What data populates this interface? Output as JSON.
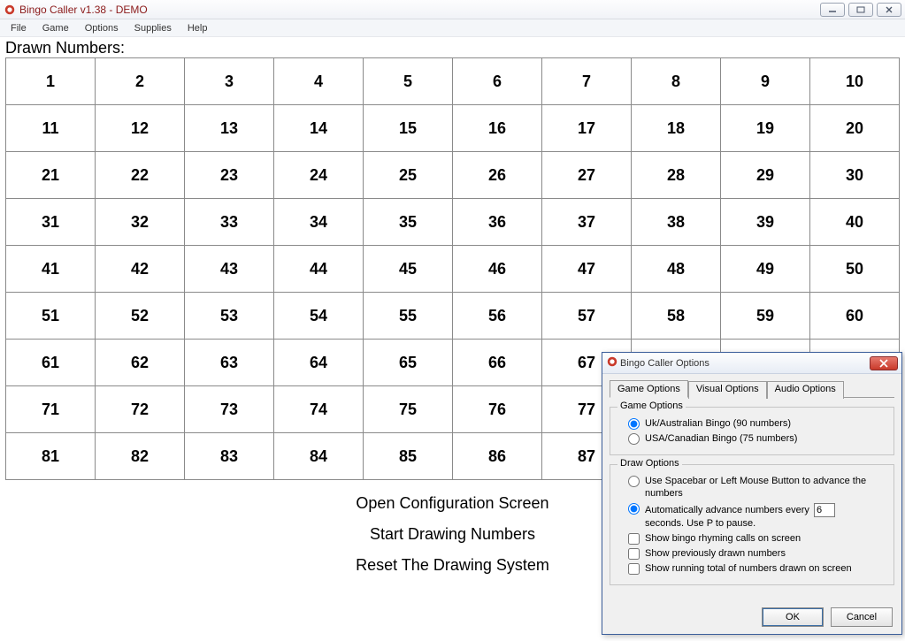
{
  "window": {
    "title": "Bingo Caller v1.38 - DEMO"
  },
  "menubar": [
    "File",
    "Game",
    "Options",
    "Supplies",
    "Help"
  ],
  "drawn_label": "Drawn Numbers:",
  "grid": {
    "rows": 9,
    "cols": 10,
    "start": 1
  },
  "actions": {
    "open_config": "Open Configuration Screen",
    "start_drawing": "Start Drawing Numbers",
    "reset": "Reset The Drawing System"
  },
  "dialog": {
    "title": "Bingo Caller Options",
    "tabs": [
      "Game Options",
      "Visual Options",
      "Audio Options"
    ],
    "active_tab": 0,
    "game_options": {
      "legend": "Game Options",
      "uk_label": "Uk/Australian Bingo (90 numbers)",
      "usa_label": "USA/Canadian Bingo (75 numbers)",
      "selected": "uk"
    },
    "draw_options": {
      "legend": "Draw Options",
      "manual_label": "Use Spacebar or Left Mouse Button to advance the numbers",
      "auto_prefix": "Automatically advance numbers every",
      "auto_value": "6",
      "auto_suffix": "seconds. Use P to pause.",
      "selected": "auto",
      "show_rhyming": "Show bingo rhyming calls on screen",
      "show_prev": "Show previously drawn numbers",
      "show_total": "Show running total of numbers drawn on screen"
    },
    "buttons": {
      "ok": "OK",
      "cancel": "Cancel"
    }
  }
}
